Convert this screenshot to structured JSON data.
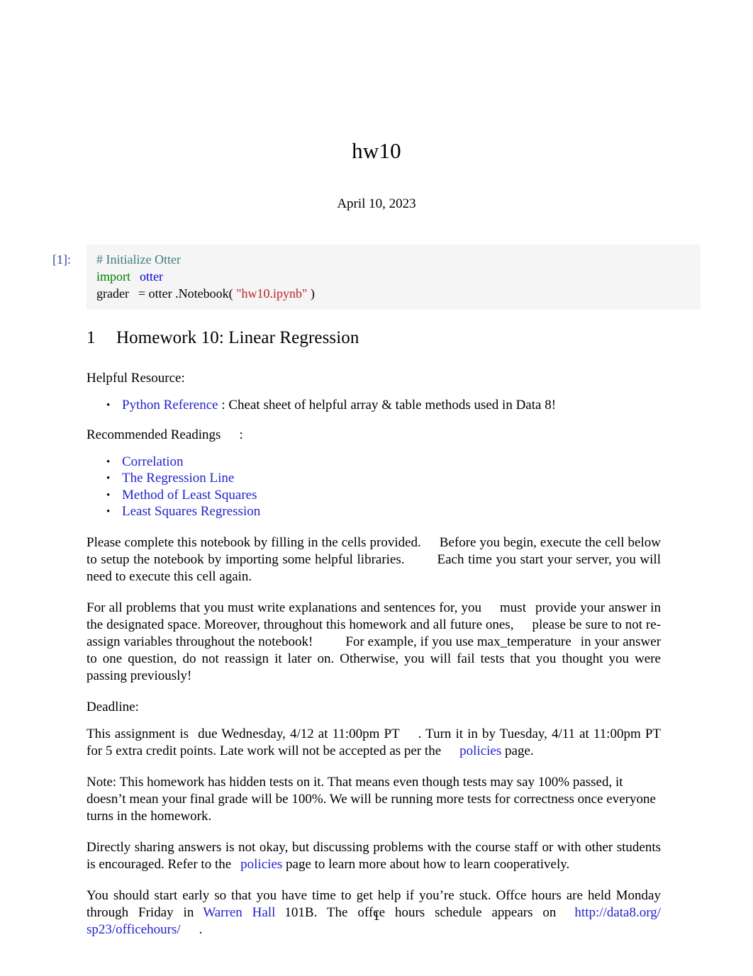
{
  "document": {
    "title": "hw10",
    "date": "April 10, 2023",
    "page_number": "1"
  },
  "code_cell": {
    "prompt": "[1]:",
    "line1_comment": "# Initialize Otter",
    "line2_keyword": "import",
    "line2_module": "otter",
    "line3_var": "grader",
    "line3_equals": "=",
    "line3_obj": "otter",
    "line3_dot": ".",
    "line3_call": "Notebook(",
    "line3_string": "\"hw10.ipynb\"",
    "line3_close": ")"
  },
  "section": {
    "number": "1",
    "heading": "Homework 10: Linear Regression"
  },
  "helpful_resource": {
    "label": "Helpful Resource:",
    "link_text": "Python Reference",
    "description": ": Cheat sheet of helpful array & table methods used in Data 8!"
  },
  "recommended_readings": {
    "label": "Recommended Readings",
    "colon": ":",
    "items": [
      "Correlation",
      "The Regression Line",
      "Method of Least Squares",
      "Least Squares Regression"
    ]
  },
  "paragraphs": {
    "setup": {
      "part1": "Please complete this notebook by filling in the cells provided.",
      "part2": "Before you begin, execute the cell below to setup the notebook by importing some helpful libraries.",
      "part3": "Each time you start your server, you will need to execute this cell again."
    },
    "explanations": {
      "part1": "For all problems that you must write explanations and sentences for, you",
      "emph1": "must",
      "part2": "provide your answer in the designated space. Moreover, throughout this homework and all future ones,",
      "emph2": "please be sure to not re-assign variables throughout the notebook!",
      "part3": "For example, if you use",
      "code": "max_temperature",
      "part4": "in your answer to one question, do not reassign it later on. Otherwise, you will fail tests that you thought you were passing previously!"
    },
    "deadline_label": "Deadline:",
    "deadline": {
      "part1": "This assignment is",
      "emph": "due Wednesday, 4/12 at 11:00pm PT",
      "part2": ". Turn it in by Tuesday, 4/11 at 11:00pm PT for 5 extra credit points. Late work will not be accepted as per the",
      "link": "policies",
      "part3": "page."
    },
    "hidden_tests": "Note: This homework has hidden tests on it. That means even though tests may say 100% passed, it doesn’t mean your final grade will be 100%. We will be running more tests for correctness once everyone turns in the homework.",
    "collaboration": {
      "part1": "Directly sharing answers is not okay, but discussing problems with the course staff or with other students is encouraged. Refer to the",
      "link": "policies",
      "part2": "page to learn more about how to learn cooperatively."
    },
    "office_hours": {
      "part1": "You should start early so that you have time to get help if you’re stuck. Offce hours are held Monday through Friday in",
      "link1": "Warren Hall",
      "part2": "101B. The offce hours schedule appears on",
      "link2": "http://data8.org/ sp23/officehours/",
      "part3": "."
    }
  },
  "colors": {
    "link": "#2222CC",
    "prompt": "#303F9F",
    "code_background": "#f5f5f5",
    "token_comment": "#3D7B7B",
    "token_keyword": "#008000",
    "token_module": "#0000DD",
    "token_string": "#BA2121"
  }
}
